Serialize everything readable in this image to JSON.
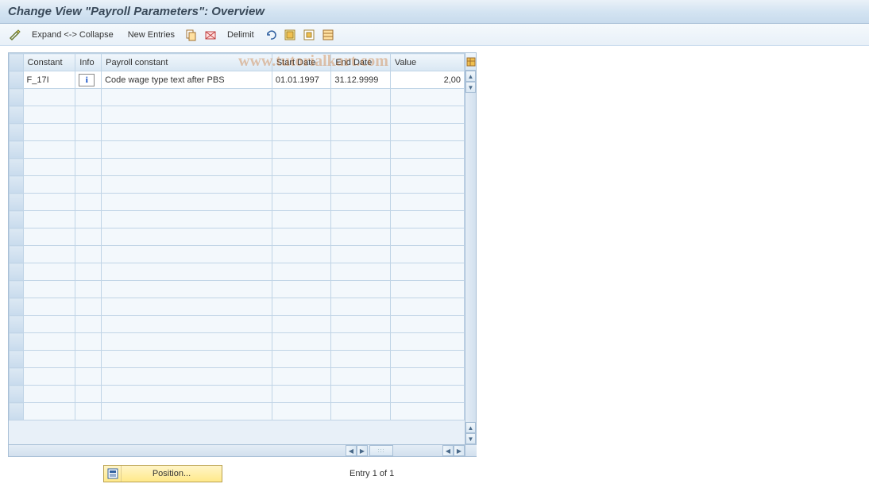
{
  "title": "Change View \"Payroll Parameters\": Overview",
  "toolbar": {
    "expand_collapse": "Expand <-> Collapse",
    "new_entries": "New Entries",
    "delimit": "Delimit"
  },
  "columns": {
    "constant": "Constant",
    "info": "Info",
    "payroll_constant": "Payroll constant",
    "start_date": "Start Date",
    "end_date": "End Date",
    "value": "Value"
  },
  "rows": [
    {
      "constant": "F_17I",
      "payroll_constant": "Code wage type text after PBS",
      "start_date": "01.01.1997",
      "end_date": "31.12.9999",
      "value": "2,00"
    }
  ],
  "position_button_label": "Position...",
  "entry_status": "Entry 1 of 1",
  "watermark": "www.tutorialkart.com"
}
